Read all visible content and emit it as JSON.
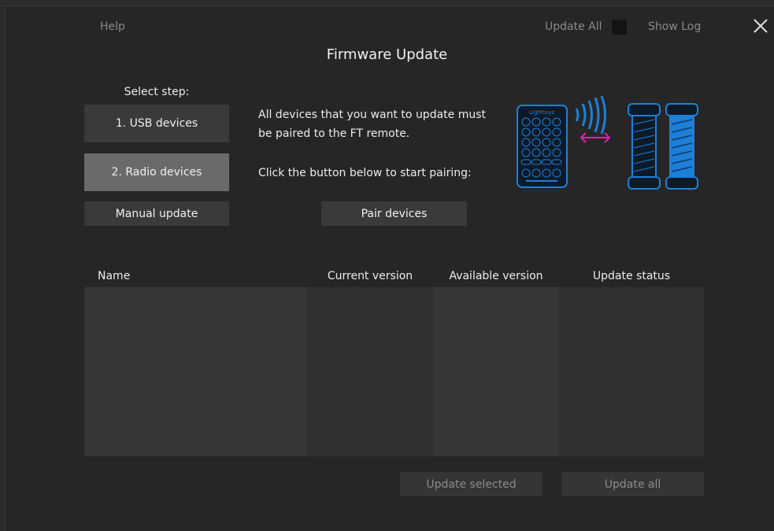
{
  "window": {
    "title": "Firmware Update"
  },
  "header": {
    "help_label": "Help",
    "update_all_label": "Update All",
    "show_log_label": "Show Log",
    "close_icon": "close-icon"
  },
  "steps": {
    "heading": "Select step:",
    "items": [
      {
        "label": "1. USB devices",
        "active": false
      },
      {
        "label": "2. Radio devices",
        "active": true
      },
      {
        "label": "Manual update",
        "active": false
      }
    ]
  },
  "info": {
    "line1": "All devices that you want to update must",
    "line2": "be paired to the FT remote.",
    "line3": "Click the button below to start pairing:",
    "pair_button": "Pair devices"
  },
  "illustration": {
    "remote_brand": "Lighttoys",
    "remote_icon": "remote-control-icon",
    "signal_icon": "radio-signal-icon",
    "arrow_icon": "bidirectional-arrow-icon",
    "device_icon": "light-tube-icon",
    "accent_blue": "#1e7fd8",
    "accent_magenta": "#e020b0"
  },
  "table": {
    "columns": [
      "Name",
      "Current version",
      "Available version",
      "Update status"
    ],
    "rows": []
  },
  "footer": {
    "update_selected_label": "Update selected",
    "update_all_label": "Update all"
  },
  "colors": {
    "background": "#262626",
    "button": "#3a3a3a",
    "button_active": "#6a6a6a",
    "table_col_light": "#363636",
    "table_col_dark": "#303030"
  }
}
